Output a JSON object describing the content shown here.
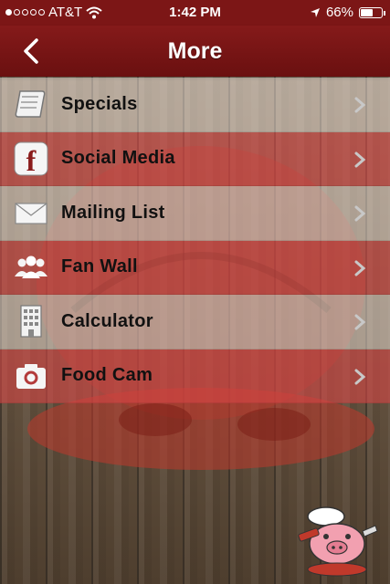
{
  "status_bar": {
    "carrier": "AT&T",
    "time": "1:42 PM",
    "battery_percent": "66%",
    "battery_level": 0.66,
    "signal_bars_filled": 1,
    "signal_bars_total": 5
  },
  "nav": {
    "title": "More",
    "back_icon": "chevron-left-icon"
  },
  "menu": {
    "items": [
      {
        "label": "Specials",
        "icon": "scroll-icon"
      },
      {
        "label": "Social Media",
        "icon": "facebook-icon"
      },
      {
        "label": "Mailing List",
        "icon": "envelope-icon"
      },
      {
        "label": "Fan Wall",
        "icon": "people-icon"
      },
      {
        "label": "Calculator",
        "icon": "building-icon"
      },
      {
        "label": "Food Cam",
        "icon": "camera-icon"
      }
    ]
  },
  "colors": {
    "brand_red": "#7c1616",
    "row_light": "#e1d7cd",
    "row_red": "#d74646"
  }
}
